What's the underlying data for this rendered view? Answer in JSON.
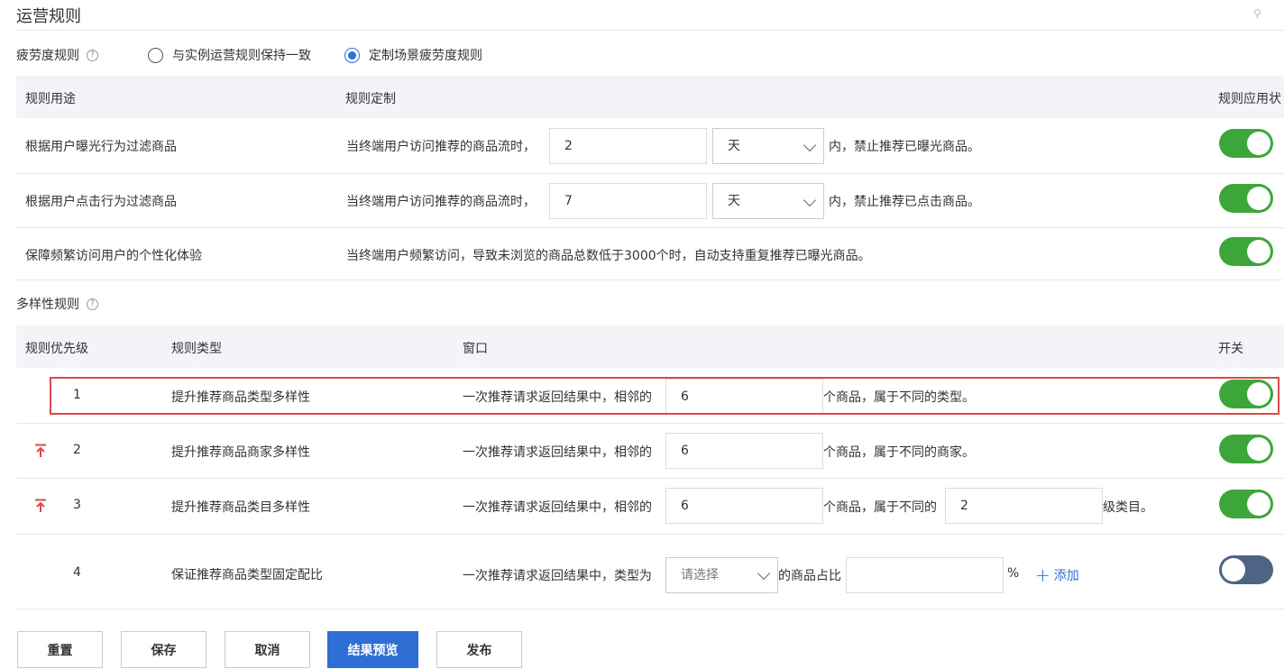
{
  "page": {
    "title": "运营规则"
  },
  "fatigue": {
    "label": "疲劳度规则",
    "help": "?",
    "options": [
      {
        "label": "与实例运营规则保持一致",
        "checked": false
      },
      {
        "label": "定制场景疲劳度规则",
        "checked": true
      }
    ],
    "headers": {
      "purpose": "规则用途",
      "custom": "规则定制",
      "status": "规则应用状"
    },
    "rows": [
      {
        "purpose": "根据用户曝光行为过滤商品",
        "prefix": "当终端用户访问推荐的商品流时，",
        "value": "2",
        "unit": "天",
        "suffix": "内，禁止推荐已曝光商品。",
        "enabled": true
      },
      {
        "purpose": "根据用户点击行为过滤商品",
        "prefix": "当终端用户访问推荐的商品流时，",
        "value": "7",
        "unit": "天",
        "suffix": "内，禁止推荐已点击商品。",
        "enabled": true
      },
      {
        "purpose": "保障频繁访问用户的个性化体验",
        "text": "当终端用户频繁访问，导致未浏览的商品总数低于3000个时，自动支持重复推荐已曝光商品。",
        "enabled": true
      }
    ]
  },
  "diversity": {
    "label": "多样性规则",
    "help": "?",
    "headers": {
      "priority": "规则优先级",
      "type": "规则类型",
      "window": "窗口",
      "switch": "开关"
    },
    "rows": [
      {
        "priority": "1",
        "type": "提升推荐商品类型多样性",
        "prefix": "一次推荐请求返回结果中，相邻的",
        "value": "6",
        "suffix": "个商品，属于不同的类型。",
        "enabled": true
      },
      {
        "priority": "2",
        "type": "提升推荐商品商家多样性",
        "prefix": "一次推荐请求返回结果中，相邻的",
        "value": "6",
        "suffix": "个商品，属于不同的商家。",
        "enabled": true
      },
      {
        "priority": "3",
        "type": "提升推荐商品类目多样性",
        "prefix": "一次推荐请求返回结果中，相邻的",
        "value": "6",
        "middle": "个商品，属于不同的",
        "value2": "2",
        "suffix": "级类目。",
        "enabled": true
      },
      {
        "priority": "4",
        "type": "保证推荐商品类型固定配比",
        "prefix": "一次推荐请求返回结果中，类型为",
        "select_placeholder": "请选择",
        "middle": "的商品占比",
        "value": "",
        "suffix": "%",
        "add_label": "添加",
        "enabled": false
      }
    ]
  },
  "buttons": {
    "reset": "重置",
    "save": "保存",
    "cancel": "取消",
    "preview": "结果预览",
    "publish": "发布"
  },
  "colors": {
    "accent": "#2f6fd3",
    "toggle_on": "#3da63b",
    "toggle_off": "#4e6487",
    "pin": "#d94b4b",
    "highlight": "#d94b4b"
  }
}
